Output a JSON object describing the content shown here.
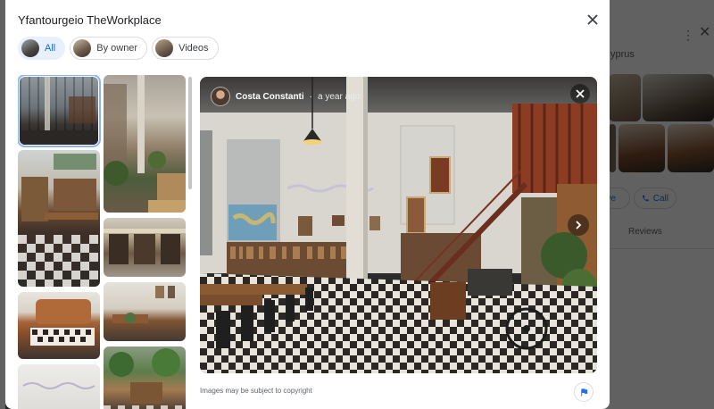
{
  "modal": {
    "title": "Yfantourgeio TheWorkplace",
    "filters": [
      {
        "label": "All",
        "active": true
      },
      {
        "label": "By owner",
        "active": false
      },
      {
        "label": "Videos",
        "active": false
      }
    ],
    "thumbnails": [
      {
        "subject": "workspace interior",
        "selected": true
      },
      {
        "subject": "courtyard plants"
      },
      {
        "subject": "bookshelves and checkered floor"
      },
      {
        "subject": "shop storefront"
      },
      {
        "subject": "leather sofa and chessboard"
      },
      {
        "subject": "interior table"
      },
      {
        "subject": "wall lettering"
      },
      {
        "subject": "garden terrace"
      }
    ],
    "photo": {
      "author": "Costa Constanti",
      "separator": "·",
      "time": "a year ago"
    },
    "copyright_text": "Images may be subject to copyright"
  },
  "background_panel": {
    "place_text": "yprus",
    "save_label": "ave",
    "call_label": "Call",
    "reviews_label": "Reviews"
  },
  "colors": {
    "accent": "#1a73e8",
    "chip_active_bg": "#e8f0fe",
    "overlay": "#5f6163"
  },
  "icons": {
    "close": "close-icon",
    "next": "chevron-right-icon",
    "report": "flag-icon",
    "call": "phone-icon",
    "more": "more-vert-icon"
  }
}
